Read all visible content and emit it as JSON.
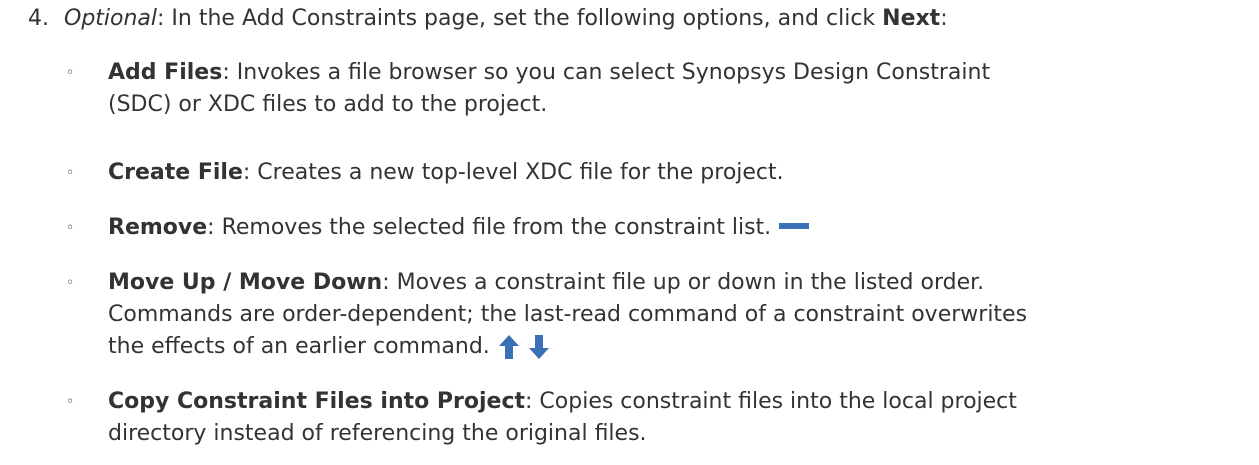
{
  "step": {
    "number": "4.",
    "optional": "Optional",
    "text_before": ": In the Add Constraints page, set the following options, and click ",
    "next": "Next",
    "text_after": ":"
  },
  "items": [
    {
      "bullet": "◦",
      "title": "Add Files",
      "line1": ": Invokes a file browser so you can select Synopsys Design Constraint",
      "line2": "(SDC) or XDC files to add to the project."
    },
    {
      "bullet": "◦",
      "title": "Create File",
      "line1": ": Creates a new top-level XDC file for the project."
    },
    {
      "bullet": "◦",
      "title": "Remove",
      "line1": ": Removes the selected file from the constraint list.",
      "icon": "remove-icon"
    },
    {
      "bullet": "◦",
      "title": "Move Up / Move Down",
      "line1": ": Moves a constraint file up or down in the listed order.",
      "line2": "Commands are order-dependent; the last-read command of a constraint overwrites",
      "line3": "the effects of an earlier command.",
      "icons": [
        "arrow-up-icon",
        "arrow-down-icon"
      ]
    },
    {
      "bullet": "◦",
      "title": "Copy Constraint Files into Project",
      "line1": ": Copies constraint files into the local project",
      "line2": "directory instead of referencing the original files."
    }
  ],
  "colors": {
    "text": "#333333",
    "icon_blue": "#3b6fb6"
  }
}
